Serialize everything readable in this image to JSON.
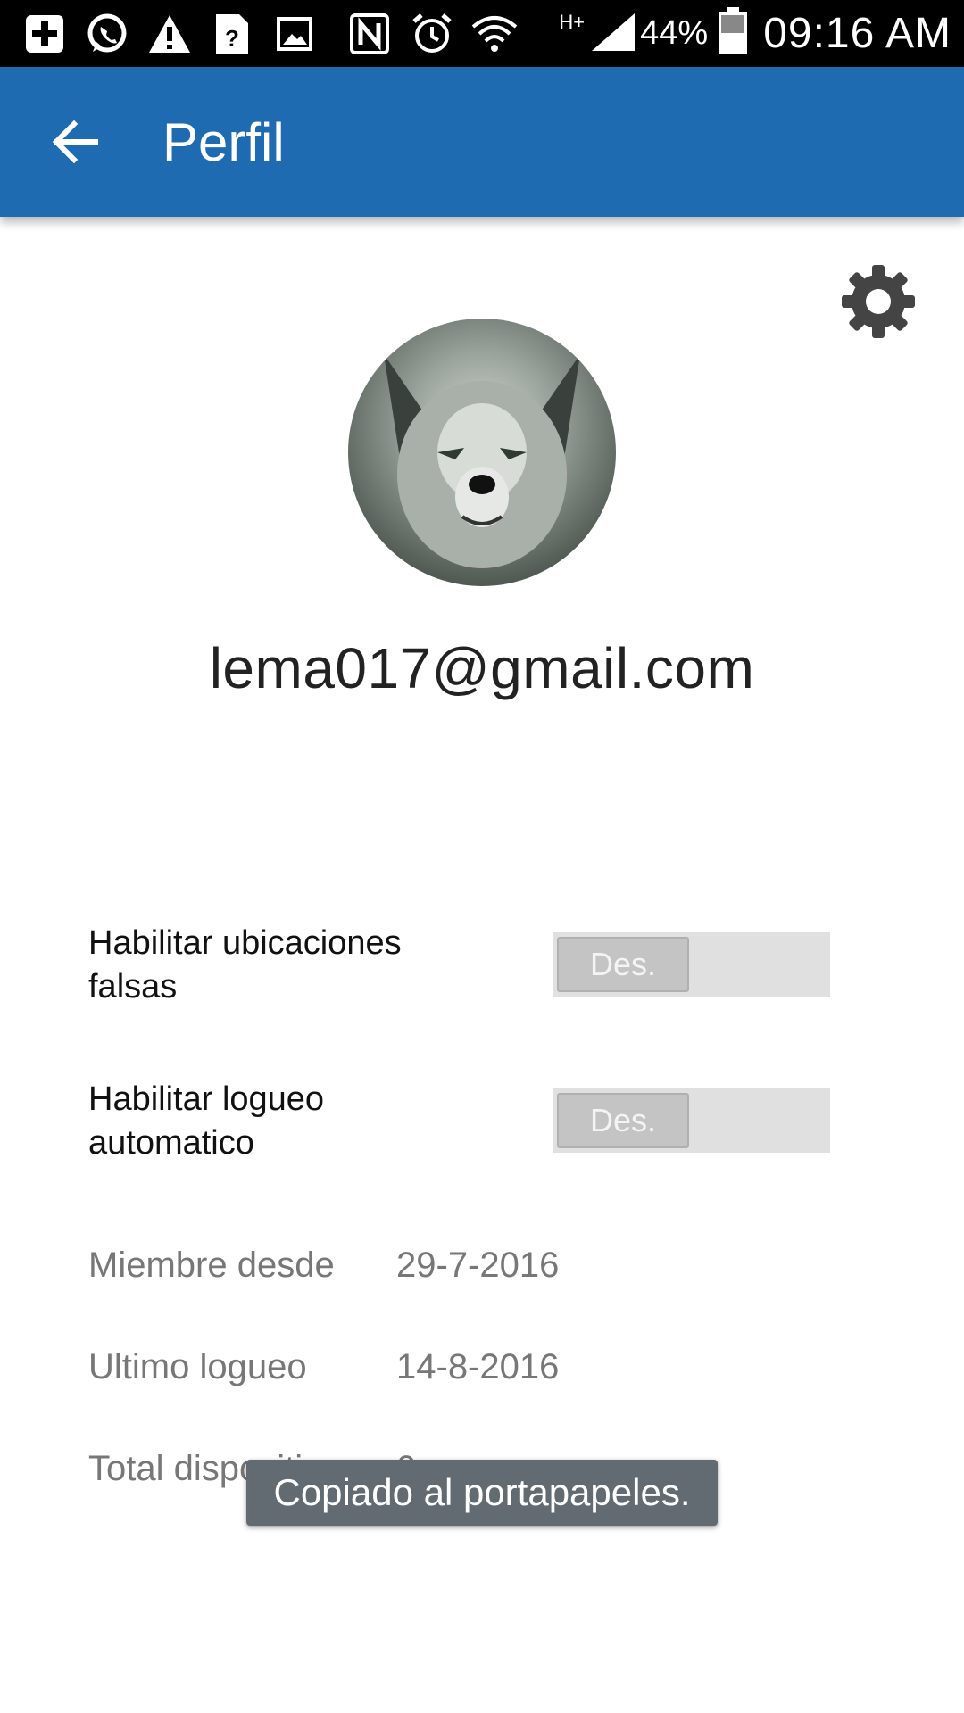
{
  "status_bar": {
    "icons": [
      "add-notification-icon",
      "whatsapp-icon",
      "warning-icon",
      "unknown-file-icon",
      "image-icon",
      "nfc-icon",
      "alarm-icon",
      "wifi-icon",
      "hplus-icon",
      "signal-icon",
      "battery-icon"
    ],
    "network": "H+",
    "battery_percent": "44%",
    "time": "09:16 AM"
  },
  "app_bar": {
    "title": "Perfil",
    "color": "#1e6bb2"
  },
  "profile": {
    "email": "lema017@gmail.com"
  },
  "settings": [
    {
      "label": "Habilitar ubicaciones falsas",
      "toggle": "Des."
    },
    {
      "label": "Habilitar logueo automatico",
      "toggle": "Des."
    }
  ],
  "info": {
    "member_since_label": "Miembre desde",
    "member_since_value": "29-7-2016",
    "last_login_label": "Ultimo logueo",
    "last_login_value": "14-8-2016",
    "total_devices_label": "Total dispositivos",
    "total_devices_value": "0"
  },
  "toast": {
    "message": "Copiado al portapapeles."
  }
}
